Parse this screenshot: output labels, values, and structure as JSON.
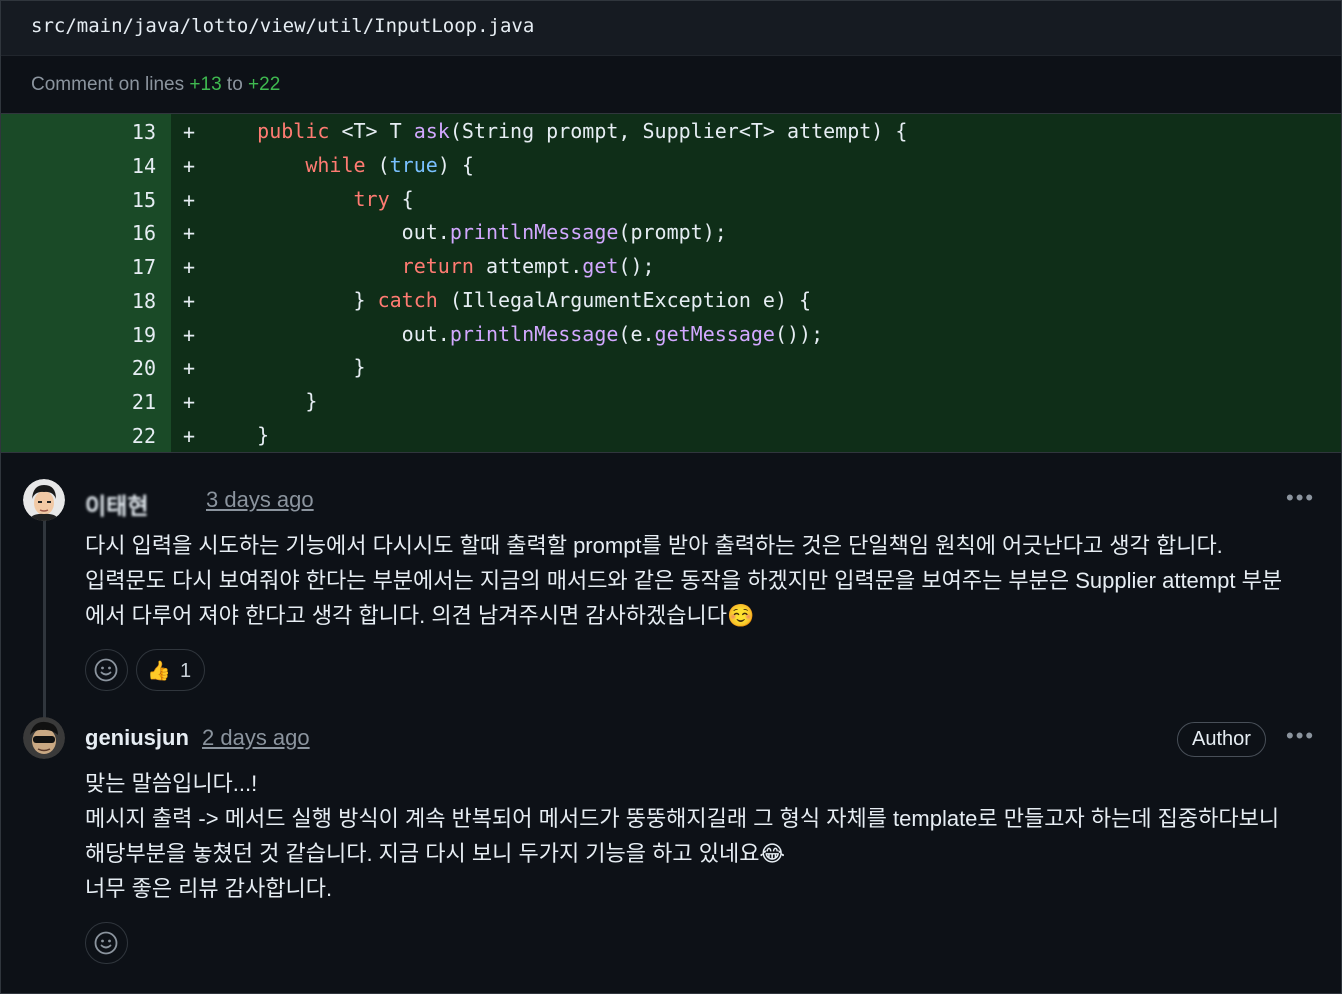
{
  "file": {
    "path": "src/main/java/lotto/view/util/InputLoop.java"
  },
  "comment_range": {
    "prefix": "Comment on lines ",
    "start": "+13",
    "middle": " to ",
    "end": "+22"
  },
  "code_lines": [
    {
      "num": "13",
      "sign": "+"
    },
    {
      "num": "14",
      "sign": "+"
    },
    {
      "num": "15",
      "sign": "+"
    },
    {
      "num": "16",
      "sign": "+"
    },
    {
      "num": "17",
      "sign": "+"
    },
    {
      "num": "18",
      "sign": "+"
    },
    {
      "num": "19",
      "sign": "+"
    },
    {
      "num": "20",
      "sign": "+"
    },
    {
      "num": "21",
      "sign": "+"
    },
    {
      "num": "22",
      "sign": "+"
    }
  ],
  "code": {
    "l13": {
      "indent": "    ",
      "kw": "public",
      "a": " <T> T ",
      "fn": "ask",
      "b": "(String prompt, Supplier<T> attempt) {"
    },
    "l14": {
      "indent": "        ",
      "kw": "while",
      "a": " (",
      "bool": "true",
      "b": ") {"
    },
    "l15": {
      "indent": "            ",
      "kw": "try",
      "a": " {"
    },
    "l16": {
      "indent": "                ",
      "a": "out.",
      "fn": "printlnMessage",
      "b": "(prompt);"
    },
    "l17": {
      "indent": "                ",
      "kw": "return",
      "a": " attempt.",
      "fn": "get",
      "b": "();"
    },
    "l18": {
      "indent": "            ",
      "a": "} ",
      "kw": "catch",
      "b": " (IllegalArgumentException e) {"
    },
    "l19": {
      "indent": "                ",
      "a": "out.",
      "fn": "printlnMessage",
      "b": "(e.",
      "fn2": "getMessage",
      "c": "());"
    },
    "l20": {
      "indent": "            ",
      "a": "}"
    },
    "l21": {
      "indent": "        ",
      "a": "}"
    },
    "l22": {
      "indent": "    ",
      "a": "}"
    }
  },
  "comments": [
    {
      "author": "이태현",
      "time": "3 days ago",
      "body": [
        "다시 입력을 시도하는 기능에서 다시시도 할때 출력할 prompt를 받아 출력하는 것은 단일책임 원칙에 어긋난다고 생각 합니다.",
        "입력문도 다시 보여줘야 한다는 부분에서는 지금의 매서드와 같은 동작을 하겠지만 입력문을 보여주는 부분은 Supplier attempt 부분",
        "에서 다루어 져야 한다고 생각 합니다. 의견 남겨주시면 감사하겠습니다☺️"
      ],
      "reaction": {
        "emoji": "👍",
        "count": "1"
      }
    },
    {
      "author": "geniusjun",
      "time": "2 days ago",
      "badge": "Author",
      "body": [
        "맞는 말씀입니다...!",
        "메시지 출력 -> 메서드 실행 방식이 계속 반복되어 메서드가 뚱뚱해지길래 그 형식 자체를 template로 만들고자 하는데 집중하다보니",
        "해당부분을 놓쳤던 것 같습니다. 지금 다시 보니 두가지 기능을 하고 있네요😂",
        "너무 좋은 리뷰 감사합니다."
      ]
    }
  ],
  "icons": {
    "more": "kebab-horizontal-icon",
    "reaction": "smiley-icon"
  },
  "colors": {
    "added_bg": "#0f2e18",
    "gutter_bg": "#1a4a27",
    "keyword": "#ff7b72",
    "function": "#d2a8ff",
    "boolean": "#79c0ff"
  }
}
